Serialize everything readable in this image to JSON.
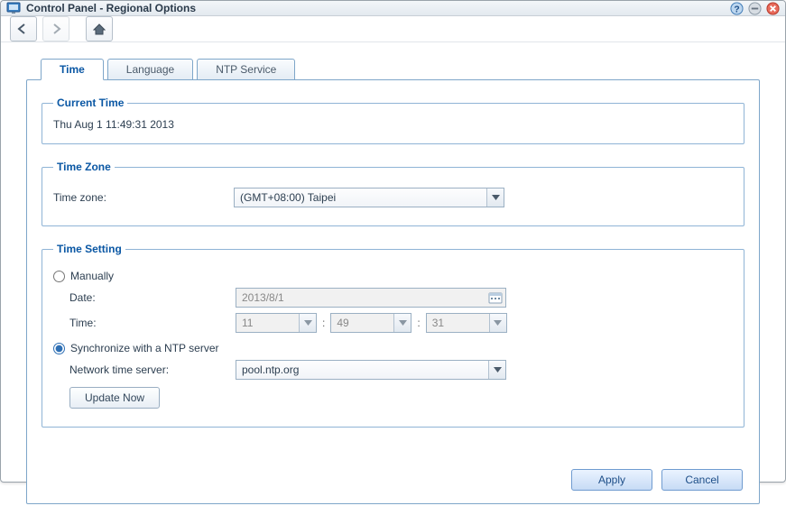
{
  "window": {
    "title": "Control Panel - Regional Options"
  },
  "tabs": {
    "time": "Time",
    "language": "Language",
    "ntp": "NTP Service"
  },
  "current_time": {
    "legend": "Current Time",
    "value": "Thu Aug 1 11:49:31 2013"
  },
  "timezone": {
    "legend": "Time Zone",
    "label": "Time zone:",
    "value": "(GMT+08:00) Taipei"
  },
  "time_setting": {
    "legend": "Time Setting",
    "manual_label": "Manually",
    "date_label": "Date:",
    "date_value": "2013/8/1",
    "time_label": "Time:",
    "hour": "11",
    "minute": "49",
    "second": "31",
    "ntp_label": "Synchronize with a NTP server",
    "server_label": "Network time server:",
    "server_value": "pool.ntp.org",
    "update_now": "Update Now"
  },
  "footer": {
    "apply": "Apply",
    "cancel": "Cancel"
  }
}
